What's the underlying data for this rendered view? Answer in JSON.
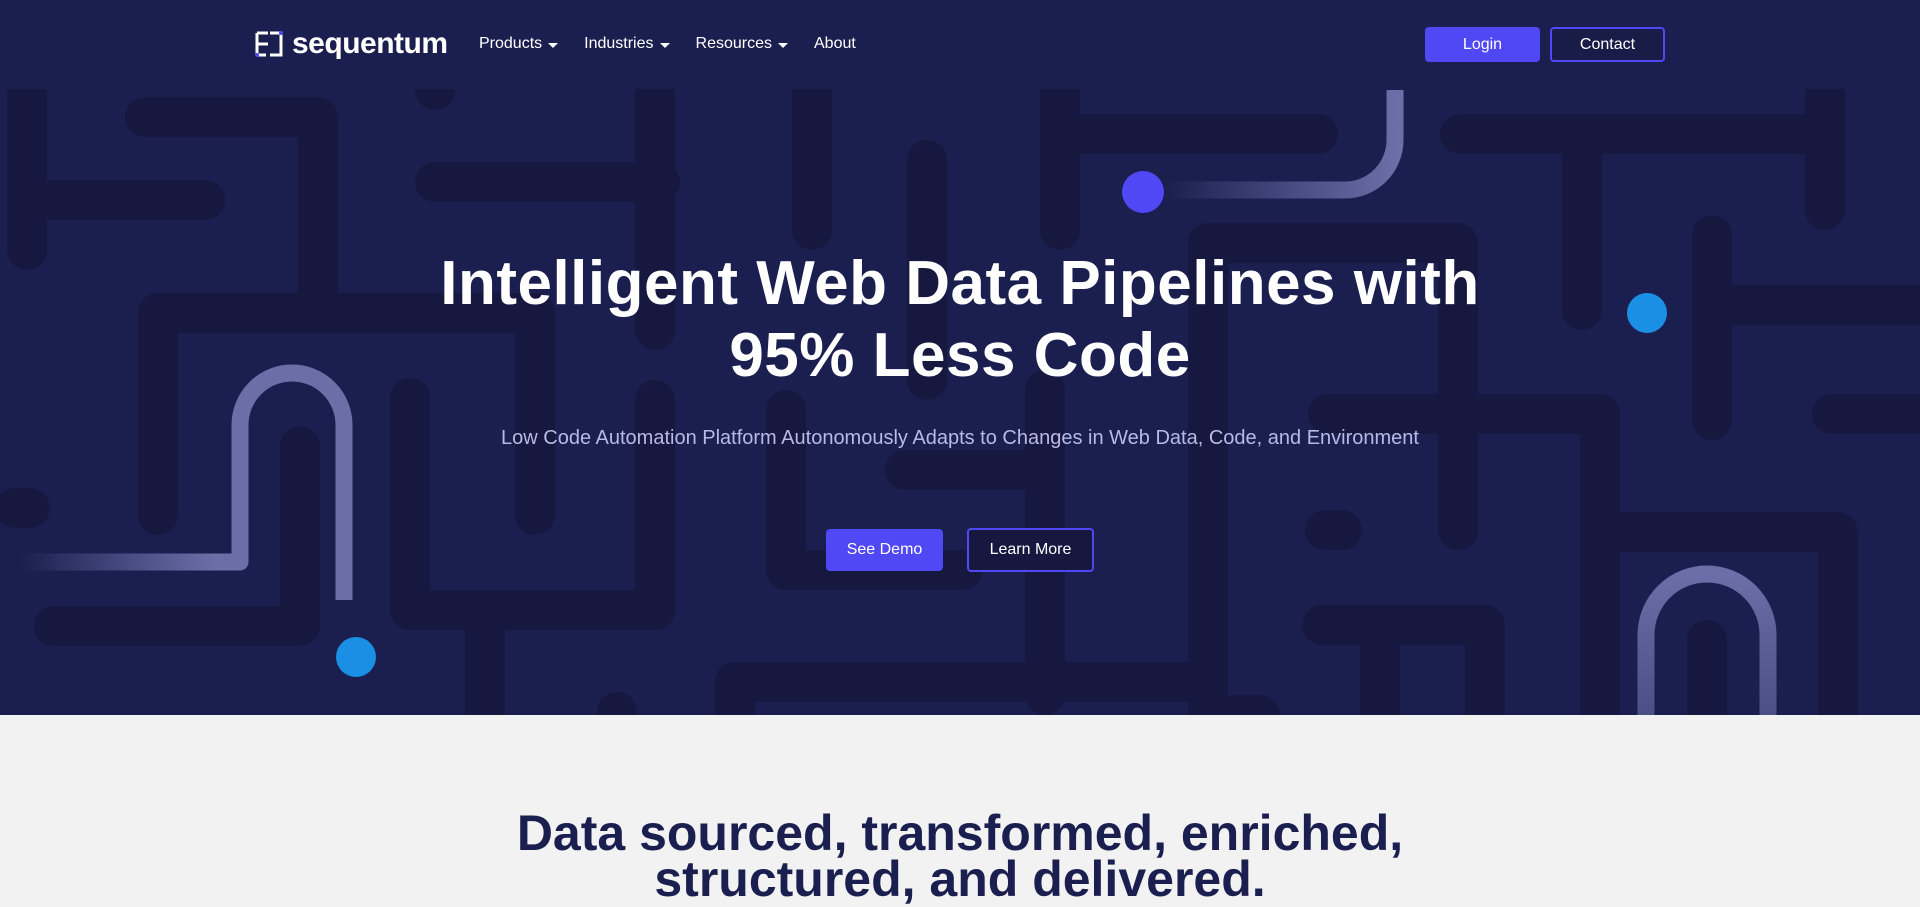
{
  "header": {
    "logo_text": "sequentum",
    "logo_icon": "sequentum-logo-icon",
    "nav": [
      {
        "label": "Products",
        "has_dropdown": true
      },
      {
        "label": "Industries",
        "has_dropdown": true
      },
      {
        "label": "Resources",
        "has_dropdown": true
      },
      {
        "label": "About",
        "has_dropdown": false
      }
    ],
    "login_label": "Login",
    "contact_label": "Contact"
  },
  "hero": {
    "title_line1": "Intelligent Web Data Pipelines with",
    "title_line2": "95% Less Code",
    "subtitle": "Low Code Automation Platform Autonomously Adapts to Changes in Web Data, Code, and Environment",
    "primary_cta": "See Demo",
    "secondary_cta": "Learn More"
  },
  "section": {
    "title_line1": "Data sourced, transformed, enriched,",
    "title_line2": "structured, and delivered."
  },
  "colors": {
    "hero_bg": "#1b1f4f",
    "maze_path": "#161840",
    "accent": "#5048f5",
    "blue_dot": "#1a8fe3",
    "trail": "#6a6fa8",
    "subtitle": "#b7b9e6",
    "section_bg": "#f2f2f2",
    "section_heading": "#1b1f4f"
  }
}
